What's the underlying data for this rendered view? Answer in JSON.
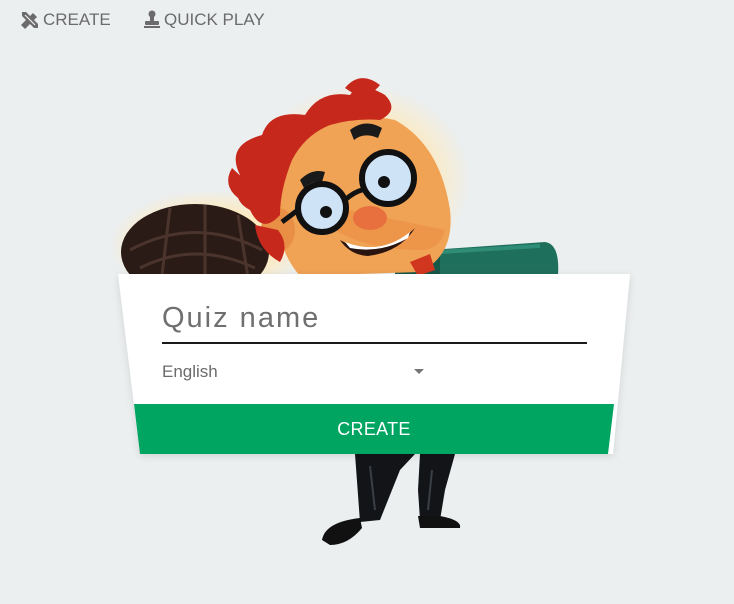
{
  "nav": {
    "create_label": "CREATE",
    "create_icon": "pencil-ruler-icon",
    "quick_play_label": "QUICK PLAY",
    "quick_play_icon": "stamp-icon"
  },
  "form": {
    "quiz_name_placeholder": "Quiz name",
    "quiz_name_value": "",
    "language_selected": "English",
    "submit_label": "CREATE"
  },
  "colors": {
    "background": "#eceff0",
    "accent_green": "#00a562",
    "nav_text": "#6b6b6b"
  }
}
